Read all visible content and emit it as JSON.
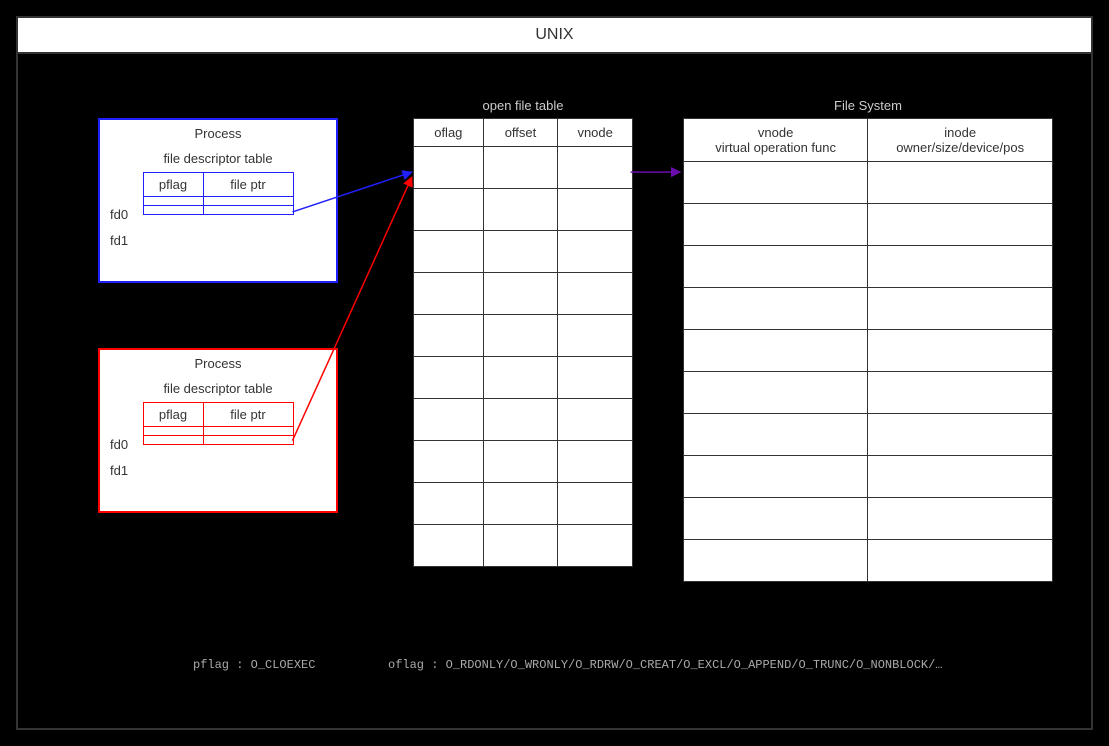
{
  "title": "UNIX",
  "processA": {
    "title": "Process",
    "subtitle": "file descriptor table",
    "cols": [
      "pflag",
      "file ptr"
    ],
    "rows": [
      "fd0",
      "fd1"
    ]
  },
  "processB": {
    "title": "Process",
    "subtitle": "file descriptor table",
    "cols": [
      "pflag",
      "file ptr"
    ],
    "rows": [
      "fd0",
      "fd1"
    ]
  },
  "openFileTable": {
    "label": "open file table",
    "cols": [
      "oflag",
      "offset",
      "vnode"
    ],
    "rowCount": 10
  },
  "fileSystem": {
    "label": "File System",
    "cols": [
      {
        "line1": "vnode",
        "line2": "virtual operation func"
      },
      {
        "line1": "inode",
        "line2": "owner/size/device/pos"
      }
    ],
    "rowCount": 10
  },
  "footnotes": {
    "pflag_label": "pflag :",
    "pflag_text": "O_CLOEXEC",
    "oflag_label": "oflag :",
    "oflag_text": "O_RDONLY/O_WRONLY/O_RDRW/O_CREAT/O_EXCL/O_APPEND/O_TRUNC/O_NONBLOCK/…"
  }
}
